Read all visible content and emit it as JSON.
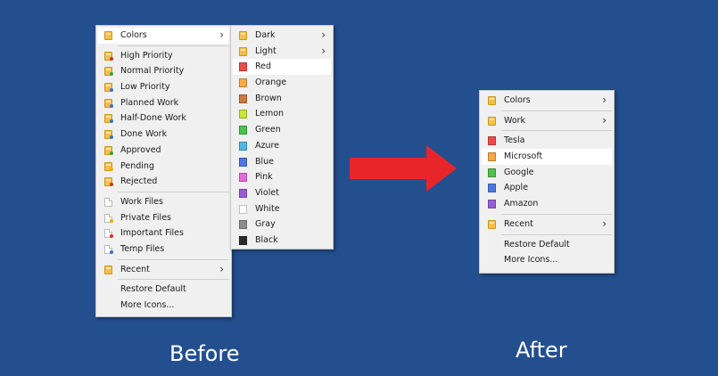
{
  "before_menu": {
    "items": [
      {
        "label": "Colors",
        "icon": "folder-icon",
        "submenu": true,
        "highlight": true
      },
      {
        "sep": true
      },
      {
        "label": "High Priority",
        "icon": "high-priority-folder-icon",
        "badge": "#e0301e"
      },
      {
        "label": "Normal Priority",
        "icon": "normal-priority-folder-icon",
        "badge": "#2ea843"
      },
      {
        "label": "Low Priority",
        "icon": "low-priority-folder-icon",
        "badge": "#2f73d6"
      },
      {
        "label": "Planned Work",
        "icon": "planned-work-folder-icon",
        "badge": "#2f73d6"
      },
      {
        "label": "Half-Done Work",
        "icon": "half-done-folder-icon",
        "badge": "#2f73d6"
      },
      {
        "label": "Done Work",
        "icon": "done-work-folder-icon",
        "badge": "#2f73d6"
      },
      {
        "label": "Approved",
        "icon": "approved-folder-icon",
        "badge": "#2ea843"
      },
      {
        "label": "Pending",
        "icon": "pending-folder-icon",
        "badge": "#f0b000"
      },
      {
        "label": "Rejected",
        "icon": "rejected-folder-icon",
        "badge": "#e0301e"
      },
      {
        "sep": true
      },
      {
        "label": "Work Files",
        "icon": "work-files-icon",
        "file": true
      },
      {
        "label": "Private Files",
        "icon": "private-files-icon",
        "file": true,
        "badge": "#e0b000"
      },
      {
        "label": "Important Files",
        "icon": "important-files-icon",
        "file": true,
        "badge": "#e0301e"
      },
      {
        "label": "Temp Files",
        "icon": "temp-files-icon",
        "file": true,
        "badge": "#2f73d6"
      },
      {
        "sep": true
      },
      {
        "label": "Recent",
        "icon": "recent-folder-icon",
        "submenu": true
      },
      {
        "sep": true
      },
      {
        "label": "Restore Default"
      },
      {
        "label": "More Icons..."
      }
    ]
  },
  "colors_submenu": {
    "items": [
      {
        "label": "Dark",
        "icon": "folder-icon",
        "submenu": true
      },
      {
        "label": "Light",
        "icon": "folder-icon",
        "submenu": true
      },
      {
        "label": "Red",
        "icon": "red-swatch-icon",
        "color": "#f04a4a",
        "highlight": true
      },
      {
        "label": "Orange",
        "icon": "orange-swatch-icon",
        "color": "#f7a944"
      },
      {
        "label": "Brown",
        "icon": "brown-swatch-icon",
        "color": "#c77a3f"
      },
      {
        "label": "Lemon",
        "icon": "lemon-swatch-icon",
        "color": "#c8e63c"
      },
      {
        "label": "Green",
        "icon": "green-swatch-icon",
        "color": "#4cc24c"
      },
      {
        "label": "Azure",
        "icon": "azure-swatch-icon",
        "color": "#52b5e6"
      },
      {
        "label": "Blue",
        "icon": "blue-swatch-icon",
        "color": "#4d78e0"
      },
      {
        "label": "Pink",
        "icon": "pink-swatch-icon",
        "color": "#e66ad9"
      },
      {
        "label": "Violet",
        "icon": "violet-swatch-icon",
        "color": "#9a5cd6"
      },
      {
        "label": "White",
        "icon": "white-swatch-icon",
        "color": "#ffffff"
      },
      {
        "label": "Gray",
        "icon": "gray-swatch-icon",
        "color": "#8c8c8c"
      },
      {
        "label": "Black",
        "icon": "black-swatch-icon",
        "color": "#2b2b2b"
      }
    ]
  },
  "after_menu": {
    "items": [
      {
        "label": "Colors",
        "icon": "folder-icon",
        "submenu": true
      },
      {
        "sep": true
      },
      {
        "label": "Work",
        "icon": "folder-icon",
        "submenu": true
      },
      {
        "sep": true
      },
      {
        "label": "Tesla",
        "icon": "red-swatch-icon",
        "color": "#f04a4a"
      },
      {
        "label": "Microsoft",
        "icon": "orange-swatch-icon",
        "color": "#f7a944",
        "highlight": true
      },
      {
        "label": "Google",
        "icon": "green-swatch-icon",
        "color": "#4cc24c"
      },
      {
        "label": "Apple",
        "icon": "blue-swatch-icon",
        "color": "#4d78e0"
      },
      {
        "label": "Amazon",
        "icon": "violet-swatch-icon",
        "color": "#9a5cd6"
      },
      {
        "sep": true
      },
      {
        "label": "Recent",
        "icon": "recent-folder-icon",
        "submenu": true
      },
      {
        "sep": true
      },
      {
        "label": "Restore Default"
      },
      {
        "label": "More Icons..."
      }
    ]
  },
  "captions": {
    "before": "Before",
    "after": "After"
  },
  "colors": {
    "background": "#244f8e",
    "arrow": "#e8262a"
  }
}
